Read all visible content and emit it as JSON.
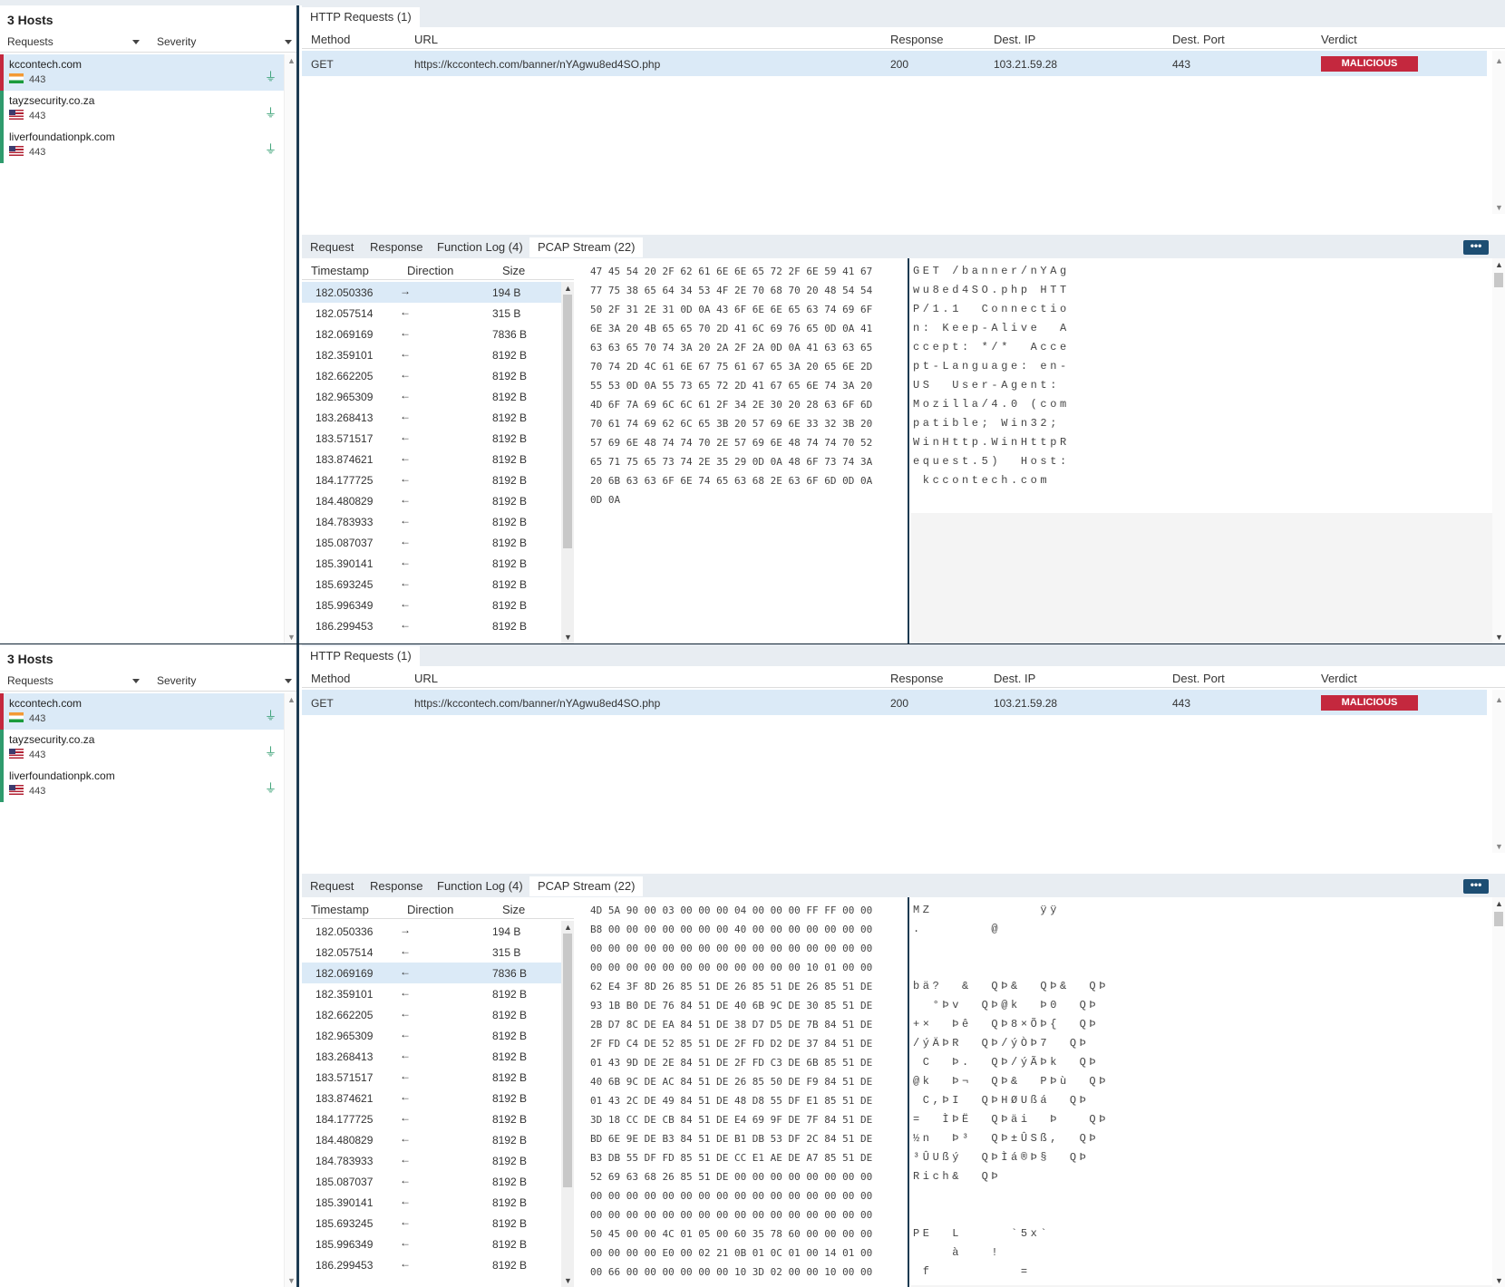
{
  "hosts": {
    "title": "3 Hosts",
    "filter_requests": "Requests",
    "filter_severity": "Severity",
    "items": [
      {
        "name": "kccontech.com",
        "port": "443",
        "flag": "in"
      },
      {
        "name": "tayzsecurity.co.za",
        "port": "443",
        "flag": "us"
      },
      {
        "name": "liverfoundationpk.com",
        "port": "443",
        "flag": "us"
      }
    ]
  },
  "http": {
    "tab": "HTTP Requests (1)",
    "headers": {
      "method": "Method",
      "url": "URL",
      "response": "Response",
      "dest_ip": "Dest. IP",
      "dest_port": "Dest. Port",
      "verdict": "Verdict"
    },
    "row": {
      "method": "GET",
      "url": "https://kccontech.com/banner/nYAgwu8ed4SO.php",
      "response": "200",
      "dest_ip": "103.21.59.28",
      "dest_port": "443",
      "verdict": "MALICIOUS"
    }
  },
  "detail_tabs": {
    "request": "Request",
    "response": "Response",
    "function_log": "Function Log (4)",
    "pcap": "PCAP Stream (22)",
    "more": "•••"
  },
  "pcap": {
    "headers": {
      "timestamp": "Timestamp",
      "direction": "Direction",
      "size": "Size"
    },
    "rows": [
      {
        "ts": "182.050336",
        "dir": "→",
        "size": "194 B"
      },
      {
        "ts": "182.057514",
        "dir": "←",
        "size": "315 B"
      },
      {
        "ts": "182.069169",
        "dir": "←",
        "size": "7836 B"
      },
      {
        "ts": "182.359101",
        "dir": "←",
        "size": "8192 B"
      },
      {
        "ts": "182.662205",
        "dir": "←",
        "size": "8192 B"
      },
      {
        "ts": "182.965309",
        "dir": "←",
        "size": "8192 B"
      },
      {
        "ts": "183.268413",
        "dir": "←",
        "size": "8192 B"
      },
      {
        "ts": "183.571517",
        "dir": "←",
        "size": "8192 B"
      },
      {
        "ts": "183.874621",
        "dir": "←",
        "size": "8192 B"
      },
      {
        "ts": "184.177725",
        "dir": "←",
        "size": "8192 B"
      },
      {
        "ts": "184.480829",
        "dir": "←",
        "size": "8192 B"
      },
      {
        "ts": "184.783933",
        "dir": "←",
        "size": "8192 B"
      },
      {
        "ts": "185.087037",
        "dir": "←",
        "size": "8192 B"
      },
      {
        "ts": "185.390141",
        "dir": "←",
        "size": "8192 B"
      },
      {
        "ts": "185.693245",
        "dir": "←",
        "size": "8192 B"
      },
      {
        "ts": "185.996349",
        "dir": "←",
        "size": "8192 B"
      },
      {
        "ts": "186.299453",
        "dir": "←",
        "size": "8192 B"
      }
    ]
  },
  "panel_top": {
    "selected_row": 0,
    "hex": "47 45 54 20 2F 62 61 6E 6E 65 72 2F 6E 59 41 67\n77 75 38 65 64 34 53 4F 2E 70 68 70 20 48 54 54\n50 2F 31 2E 31 0D 0A 43 6F 6E 6E 65 63 74 69 6F\n6E 3A 20 4B 65 65 70 2D 41 6C 69 76 65 0D 0A 41\n63 63 65 70 74 3A 20 2A 2F 2A 0D 0A 41 63 63 65\n70 74 2D 4C 61 6E 67 75 61 67 65 3A 20 65 6E 2D\n55 53 0D 0A 55 73 65 72 2D 41 67 65 6E 74 3A 20\n4D 6F 7A 69 6C 6C 61 2F 34 2E 30 20 28 63 6F 6D\n70 61 74 69 62 6C 65 3B 20 57 69 6E 33 32 3B 20\n57 69 6E 48 74 74 70 2E 57 69 6E 48 74 74 70 52\n65 71 75 65 73 74 2E 35 29 0D 0A 48 6F 73 74 3A\n20 6B 63 63 6F 6E 74 65 63 68 2E 63 6F 6D 0D 0A\n0D 0A",
    "ascii": "GET /banner/nYAg\nwu8ed4SO.php HTT\nP/1.1  Connectio\nn: Keep-Alive  A\nccept: */*  Acce\npt-Language: en-\nUS  User-Agent: \nMozilla/4.0 (com\npatible; Win32; \nWinHttp.WinHttpR\nequest.5)  Host:\n kccontech.com"
  },
  "panel_bottom": {
    "selected_row": 2,
    "hex": "4D 5A 90 00 03 00 00 00 04 00 00 00 FF FF 00 00\nB8 00 00 00 00 00 00 00 40 00 00 00 00 00 00 00\n00 00 00 00 00 00 00 00 00 00 00 00 00 00 00 00\n00 00 00 00 00 00 00 00 00 00 00 00 10 01 00 00\n62 E4 3F 8D 26 85 51 DE 26 85 51 DE 26 85 51 DE\n93 1B B0 DE 76 84 51 DE 40 6B 9C DE 30 85 51 DE\n2B D7 8C DE EA 84 51 DE 38 D7 D5 DE 7B 84 51 DE\n2F FD C4 DE 52 85 51 DE 2F FD D2 DE 37 84 51 DE\n01 43 9D DE 2E 84 51 DE 2F FD C3 DE 6B 85 51 DE\n40 6B 9C DE AC 84 51 DE 26 85 50 DE F9 84 51 DE\n01 43 2C DE 49 84 51 DE 48 D8 55 DF E1 85 51 DE\n3D 18 CC DE CB 84 51 DE E4 69 9F DE 7F 84 51 DE\nBD 6E 9E DE B3 84 51 DE B1 DB 53 DF 2C 84 51 DE\nB3 DB 55 DF FD 85 51 DE CC E1 AE DE A7 85 51 DE\n52 69 63 68 26 85 51 DE 00 00 00 00 00 00 00 00\n00 00 00 00 00 00 00 00 00 00 00 00 00 00 00 00\n00 00 00 00 00 00 00 00 00 00 00 00 00 00 00 00\n50 45 00 00 4C 01 05 00 60 35 78 60 00 00 00 00\n00 00 00 00 E0 00 02 21 0B 01 0C 01 00 14 01 00\n00 66 00 00 00 00 00 00 10 3D 02 00 00 10 00 00",
    "ascii": "MZ           ÿÿ  \n.       @       \n                \n                \nbä?  &  QÞ&  QÞ&  QÞ\n  °Þv  QÞ@k  Þ0  QÞ\n+×  Þê  QÞ8×ÕÞ{  QÞ\n/ýÄÞR  QÞ/ýÒÞ7  QÞ\n C  Þ.  QÞ/ýÃÞk  QÞ\n@k  Þ¬  QÞ&  PÞù  QÞ\n C,ÞI  QÞHØUßá  QÞ\n=  ÌÞË  QÞäi  Þ   QÞ\n½n  Þ³  QÞ±ÛSß,  QÞ\n³ÛUßý  QÞÌá®Þ§  QÞ\nRich&  QÞ\n\n\nPE  L     `5x`\n    à   !\n f         ="
  }
}
